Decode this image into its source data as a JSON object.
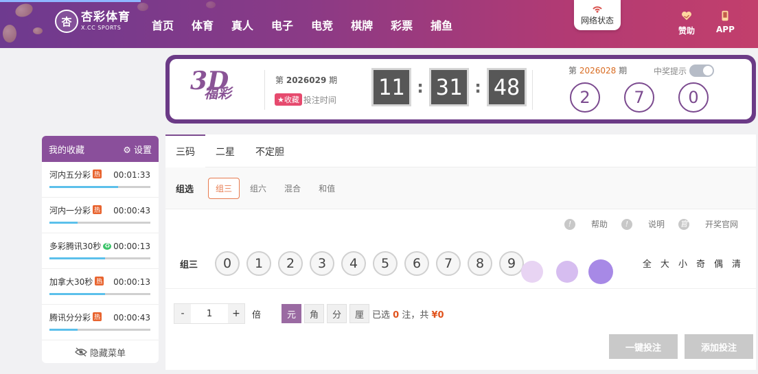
{
  "brand": {
    "name": "杏彩体育",
    "sub": "X.CC SPORTS",
    "mark": "杏"
  },
  "nav": [
    "首页",
    "体育",
    "真人",
    "电子",
    "电竞",
    "棋牌",
    "彩票",
    "捕鱼"
  ],
  "net_status": "网络状态",
  "tools": [
    {
      "label": "赞助",
      "icon": "heart-hand-icon"
    },
    {
      "label": "APP",
      "icon": "phone-icon"
    }
  ],
  "lottery": {
    "logo_big": "3D",
    "logo_small": "福彩",
    "issue_prefix": "第",
    "issue": "2026029",
    "issue_suffix": "期",
    "fav_label": "收藏",
    "bet_time_label": "投注时间",
    "countdown": [
      "11",
      "31",
      "48"
    ],
    "prev_issue": "2026028",
    "notify_label": "中奖提示",
    "result": [
      "2",
      "7",
      "0"
    ]
  },
  "favorites": {
    "title": "我的收藏",
    "settings": "设置",
    "items": [
      {
        "name": "河内五分彩",
        "badge": "热",
        "time": "00:01:33",
        "progress": 0.68
      },
      {
        "name": "河内一分彩",
        "badge": "热",
        "time": "00:00:43",
        "progress": 0.28
      },
      {
        "name": "多彩腾讯30秒",
        "badge": "♻",
        "time": "00:00:13",
        "progress": 0.55
      },
      {
        "name": "加拿大30秒",
        "badge": "热",
        "time": "00:00:13",
        "progress": 0.55
      },
      {
        "name": "腾讯分分彩",
        "badge": "热",
        "time": "00:00:43",
        "progress": 0.28
      }
    ],
    "hide_menu": "隐藏菜单"
  },
  "tabs": [
    "三码",
    "二星",
    "不定胆"
  ],
  "sub": {
    "label": "组选",
    "options": [
      "组三",
      "组六",
      "混合",
      "和值"
    ]
  },
  "help": [
    "帮助",
    "说明",
    "开奖官网"
  ],
  "picker": {
    "label": "组三",
    "numbers": [
      "0",
      "1",
      "2",
      "3",
      "4",
      "5",
      "6",
      "7",
      "8",
      "9"
    ],
    "quick": [
      "全",
      "大",
      "小",
      "奇",
      "偶",
      "清"
    ]
  },
  "bet": {
    "minus": "-",
    "value": "1",
    "plus": "+",
    "times": "倍",
    "units": [
      "元",
      "角",
      "分",
      "厘"
    ],
    "selected_prefix": "已选",
    "count": "0",
    "count_suffix": "注，共",
    "amount": "¥0"
  },
  "actions": [
    "一键投注",
    "添加投注"
  ],
  "colors": {
    "brand": "#7b4a8f",
    "accent": "#e0531d"
  }
}
